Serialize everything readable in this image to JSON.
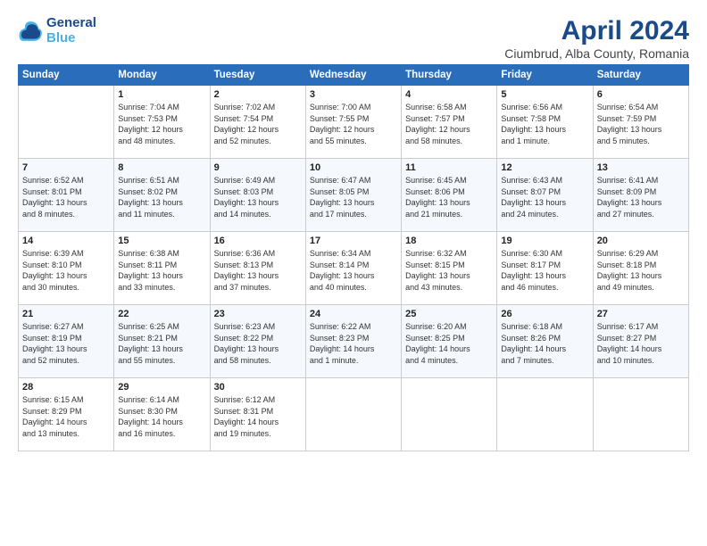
{
  "header": {
    "logo_line1": "General",
    "logo_line2": "Blue",
    "title": "April 2024",
    "location": "Ciumbrud, Alba County, Romania"
  },
  "weekdays": [
    "Sunday",
    "Monday",
    "Tuesday",
    "Wednesday",
    "Thursday",
    "Friday",
    "Saturday"
  ],
  "weeks": [
    [
      {
        "day": "",
        "info": ""
      },
      {
        "day": "1",
        "info": "Sunrise: 7:04 AM\nSunset: 7:53 PM\nDaylight: 12 hours\nand 48 minutes."
      },
      {
        "day": "2",
        "info": "Sunrise: 7:02 AM\nSunset: 7:54 PM\nDaylight: 12 hours\nand 52 minutes."
      },
      {
        "day": "3",
        "info": "Sunrise: 7:00 AM\nSunset: 7:55 PM\nDaylight: 12 hours\nand 55 minutes."
      },
      {
        "day": "4",
        "info": "Sunrise: 6:58 AM\nSunset: 7:57 PM\nDaylight: 12 hours\nand 58 minutes."
      },
      {
        "day": "5",
        "info": "Sunrise: 6:56 AM\nSunset: 7:58 PM\nDaylight: 13 hours\nand 1 minute."
      },
      {
        "day": "6",
        "info": "Sunrise: 6:54 AM\nSunset: 7:59 PM\nDaylight: 13 hours\nand 5 minutes."
      }
    ],
    [
      {
        "day": "7",
        "info": "Sunrise: 6:52 AM\nSunset: 8:01 PM\nDaylight: 13 hours\nand 8 minutes."
      },
      {
        "day": "8",
        "info": "Sunrise: 6:51 AM\nSunset: 8:02 PM\nDaylight: 13 hours\nand 11 minutes."
      },
      {
        "day": "9",
        "info": "Sunrise: 6:49 AM\nSunset: 8:03 PM\nDaylight: 13 hours\nand 14 minutes."
      },
      {
        "day": "10",
        "info": "Sunrise: 6:47 AM\nSunset: 8:05 PM\nDaylight: 13 hours\nand 17 minutes."
      },
      {
        "day": "11",
        "info": "Sunrise: 6:45 AM\nSunset: 8:06 PM\nDaylight: 13 hours\nand 21 minutes."
      },
      {
        "day": "12",
        "info": "Sunrise: 6:43 AM\nSunset: 8:07 PM\nDaylight: 13 hours\nand 24 minutes."
      },
      {
        "day": "13",
        "info": "Sunrise: 6:41 AM\nSunset: 8:09 PM\nDaylight: 13 hours\nand 27 minutes."
      }
    ],
    [
      {
        "day": "14",
        "info": "Sunrise: 6:39 AM\nSunset: 8:10 PM\nDaylight: 13 hours\nand 30 minutes."
      },
      {
        "day": "15",
        "info": "Sunrise: 6:38 AM\nSunset: 8:11 PM\nDaylight: 13 hours\nand 33 minutes."
      },
      {
        "day": "16",
        "info": "Sunrise: 6:36 AM\nSunset: 8:13 PM\nDaylight: 13 hours\nand 37 minutes."
      },
      {
        "day": "17",
        "info": "Sunrise: 6:34 AM\nSunset: 8:14 PM\nDaylight: 13 hours\nand 40 minutes."
      },
      {
        "day": "18",
        "info": "Sunrise: 6:32 AM\nSunset: 8:15 PM\nDaylight: 13 hours\nand 43 minutes."
      },
      {
        "day": "19",
        "info": "Sunrise: 6:30 AM\nSunset: 8:17 PM\nDaylight: 13 hours\nand 46 minutes."
      },
      {
        "day": "20",
        "info": "Sunrise: 6:29 AM\nSunset: 8:18 PM\nDaylight: 13 hours\nand 49 minutes."
      }
    ],
    [
      {
        "day": "21",
        "info": "Sunrise: 6:27 AM\nSunset: 8:19 PM\nDaylight: 13 hours\nand 52 minutes."
      },
      {
        "day": "22",
        "info": "Sunrise: 6:25 AM\nSunset: 8:21 PM\nDaylight: 13 hours\nand 55 minutes."
      },
      {
        "day": "23",
        "info": "Sunrise: 6:23 AM\nSunset: 8:22 PM\nDaylight: 13 hours\nand 58 minutes."
      },
      {
        "day": "24",
        "info": "Sunrise: 6:22 AM\nSunset: 8:23 PM\nDaylight: 14 hours\nand 1 minute."
      },
      {
        "day": "25",
        "info": "Sunrise: 6:20 AM\nSunset: 8:25 PM\nDaylight: 14 hours\nand 4 minutes."
      },
      {
        "day": "26",
        "info": "Sunrise: 6:18 AM\nSunset: 8:26 PM\nDaylight: 14 hours\nand 7 minutes."
      },
      {
        "day": "27",
        "info": "Sunrise: 6:17 AM\nSunset: 8:27 PM\nDaylight: 14 hours\nand 10 minutes."
      }
    ],
    [
      {
        "day": "28",
        "info": "Sunrise: 6:15 AM\nSunset: 8:29 PM\nDaylight: 14 hours\nand 13 minutes."
      },
      {
        "day": "29",
        "info": "Sunrise: 6:14 AM\nSunset: 8:30 PM\nDaylight: 14 hours\nand 16 minutes."
      },
      {
        "day": "30",
        "info": "Sunrise: 6:12 AM\nSunset: 8:31 PM\nDaylight: 14 hours\nand 19 minutes."
      },
      {
        "day": "",
        "info": ""
      },
      {
        "day": "",
        "info": ""
      },
      {
        "day": "",
        "info": ""
      },
      {
        "day": "",
        "info": ""
      }
    ]
  ]
}
